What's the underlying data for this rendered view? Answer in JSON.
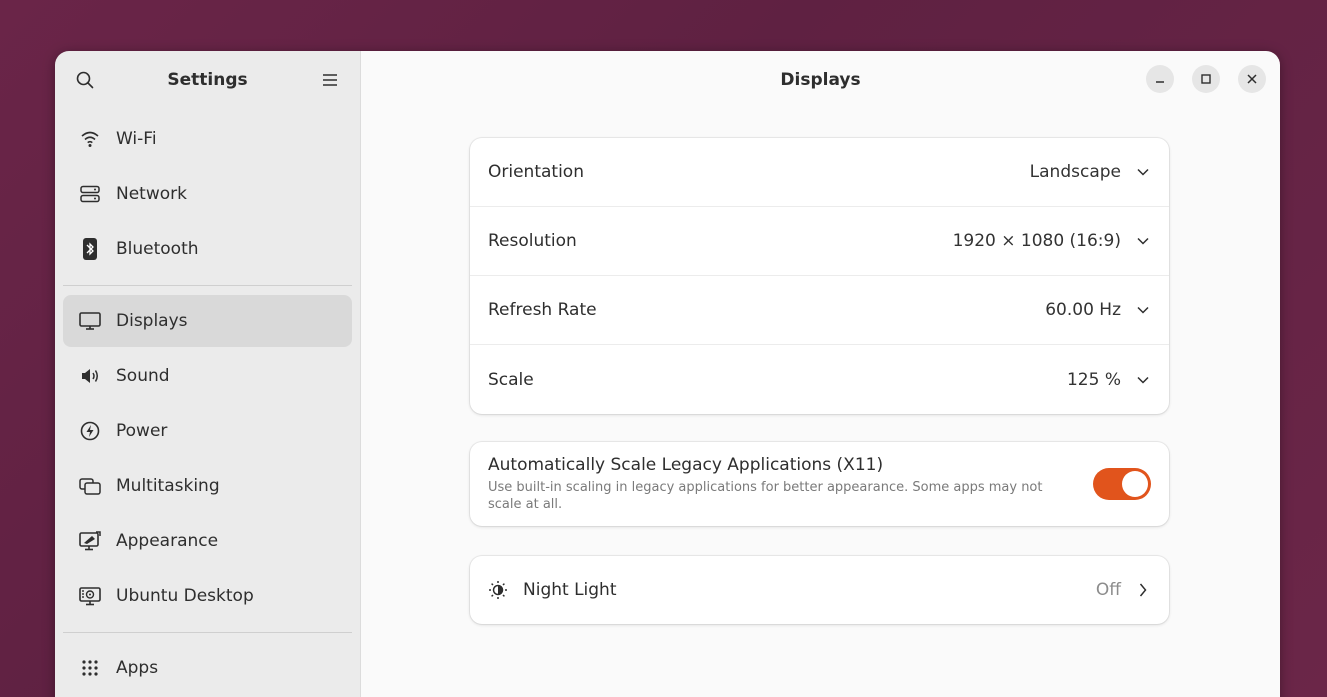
{
  "sidebar": {
    "title": "Settings",
    "search_icon": "search-icon",
    "menu_icon": "hamburger-menu-icon",
    "items": [
      {
        "label": "Wi-Fi",
        "icon": "wifi-icon"
      },
      {
        "label": "Network",
        "icon": "network-icon"
      },
      {
        "label": "Bluetooth",
        "icon": "bluetooth-icon"
      },
      {
        "label": "Displays",
        "icon": "display-icon",
        "active": true
      },
      {
        "label": "Sound",
        "icon": "speaker-icon"
      },
      {
        "label": "Power",
        "icon": "power-icon"
      },
      {
        "label": "Multitasking",
        "icon": "multitasking-icon"
      },
      {
        "label": "Appearance",
        "icon": "appearance-icon"
      },
      {
        "label": "Ubuntu Desktop",
        "icon": "ubuntu-desktop-icon"
      },
      {
        "label": "Apps",
        "icon": "apps-grid-icon"
      }
    ]
  },
  "header": {
    "title": "Displays"
  },
  "display_settings": {
    "rows": [
      {
        "label": "Orientation",
        "value": "Landscape"
      },
      {
        "label": "Resolution",
        "value": "1920 × 1080 (16:9)"
      },
      {
        "label": "Refresh Rate",
        "value": "60.00 Hz"
      },
      {
        "label": "Scale",
        "value": "125 %"
      }
    ]
  },
  "legacy_scaling": {
    "title": "Automatically Scale Legacy Applications (X11)",
    "subtitle": "Use built-in scaling in legacy applications for better appearance. Some apps may not scale at all.",
    "enabled": true
  },
  "night_light": {
    "label": "Night Light",
    "value": "Off"
  },
  "colors": {
    "accent": "#e1541c",
    "desktop_bg": "#6a2548"
  }
}
